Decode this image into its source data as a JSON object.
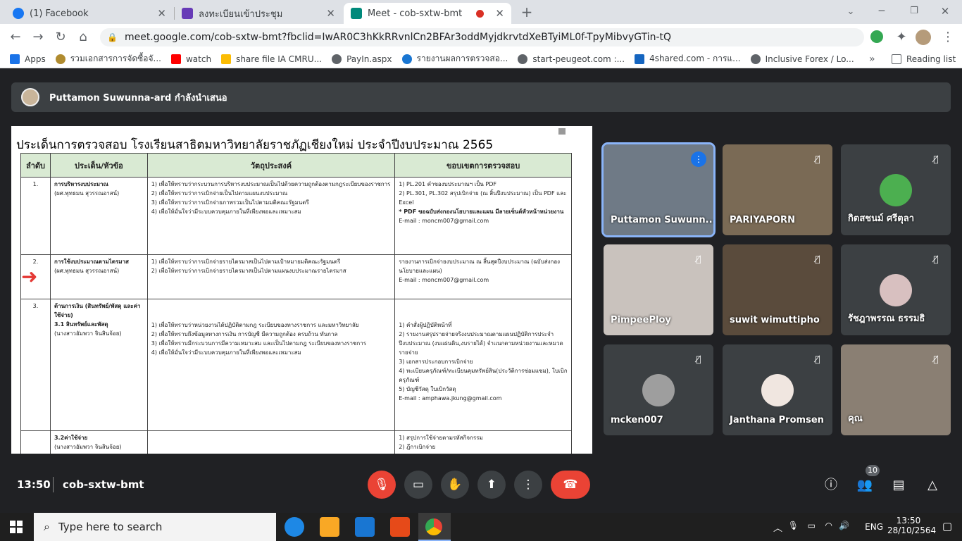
{
  "tabs": [
    {
      "title": "(1) Facebook",
      "color": "#1877f2"
    },
    {
      "title": "ลงทะเบียนเข้าประชุม",
      "color": "#673ab7"
    },
    {
      "title": "Meet - cob-sxtw-bmt",
      "color": "#00897b"
    }
  ],
  "omnibox": {
    "url": "meet.google.com/cob-sxtw-bmt?fbclid=IwAR0C3hKkRRvnlCn2BFAr3oddMyjdkrvtdXeBTyiML0f-TpyMibvyGTin-tQ"
  },
  "bookmarks": [
    {
      "label": "Apps",
      "color": "#1a73e8"
    },
    {
      "label": "รวมเอกสารการจัดซื้อจั...",
      "color": "#b08b2f"
    },
    {
      "label": "watch",
      "color": "#ff0000"
    },
    {
      "label": "share file IA CMRU...",
      "color": "#fbbc04"
    },
    {
      "label": "PayIn.aspx",
      "color": "#5f6368"
    },
    {
      "label": "รายงานผลการตรวจสอ...",
      "color": "#1976d2"
    },
    {
      "label": "start-peugeot.com :...",
      "color": "#5f6368"
    },
    {
      "label": "4shared.com - การแ...",
      "color": "#1565c0"
    },
    {
      "label": "Inclusive Forex / Lo...",
      "color": "#5f6368"
    }
  ],
  "reading_list": "Reading list",
  "presenter": {
    "text": "Puttamon Suwunna-ard กำลังนำเสนอ"
  },
  "slide": {
    "title": "ประเด็นการตรวจสอบ โรงเรียนสาธิตมหาวิทยาลัยราชภัฏเชียงใหม่ ประจำปีงบประมาณ 2565",
    "headers": [
      "ลำดับ",
      "ประเด็น/หัวข้อ",
      "วัตถุประสงค์",
      "ขอบเขตการตรวจสอบ"
    ],
    "rows": [
      {
        "no": "1.",
        "topic": "การบริหารงบประมาณ",
        "owner": "(ผศ.พุทธมน สุวรรณอาสน์)",
        "objectives": [
          "1) เพื่อให้ทราบว่ากระบวนการบริหารงบประมาณเป็นไปด้วยความถูกต้องตามกฎระเบียบของราชการ",
          "2) เพื่อให้ทราบว่าการเบิกจ่ายเป็นไปตามแผนงบประมาณ",
          "3) เพื่อให้ทราบว่าการเบิกจ่ายภาพรวมเป็นไปตามมติคณะรัฐมนตรี",
          "4) เพื่อให้มั่นใจว่ามีระบบควบคุมภายในที่เพียงพอและเหมาะสม"
        ],
        "scope": [
          "1) PL.201 คำของบประมาณฯ เป็น PDF",
          "2) PL.301, PL.302 สรุปเบิกจ่าย (ณ สิ้นปีงบประมาณ) เป็น PDF และ Excel",
          "* PDF ขอฉบับส่งกองนโยบายและแผน มีลายเซ็นต์หัวหน้าหน่วยงาน",
          "E-mail : moncm007@gmail.com"
        ]
      },
      {
        "no": "2.",
        "topic": "การใช้งบประมาณตามไตรมาส",
        "owner": "(ผศ.พุทธมน สุวรรณอาสน์)",
        "objectives": [
          "1) เพื่อให้ทราบว่าการเบิกจ่ายรายไตรมาสเป็นไปตามเป้าหมายมติคณะรัฐมนตรี",
          "2) เพื่อให้ทราบว่าการเบิกจ่ายรายไตรมาสเป็นไปตามแผนงบประมาณรายไตรมาส"
        ],
        "scope": [
          "รายงานการเบิกจ่ายงบประมาณ ณ สิ้นสุดปีงบประมาณ (ฉบับส่งกองนโยบายและแผน)",
          "E-mail : moncm007@gmail.com"
        ]
      },
      {
        "no": "3.",
        "topic": "ด้านการเงิน (สินทรัพย์/พัสดุ และค่าใช้จ่าย)",
        "sub": "3.1 สินทรัพย์และพัสดุ",
        "owner": "(นางสาวอัมพวา จินสินจ้อย)",
        "objectives": [
          "1) เพื่อให้ทราบว่าหน่วยงานได้ปฏิบัติตามกฎ ระเบียบของทางราชการ และมหาวิทยาลัย",
          "2) เพื่อให้ทราบถึงข้อมูลทางการเงิน การบัญชี มีความถูกต้อง ครบถ้วน ทันกาล",
          "3) เพื่อให้ทราบมีกระบวนการมีความเหมาะสม และเป็นไปตามกฎ ระเบียบของทางราชการ",
          "4) เพื่อให้มั่นใจว่ามีระบบควบคุมภายในที่เพียงพอและเหมาะสม"
        ],
        "scope": [
          "1) คำสั่งผู้ปฏิบัติหน้าที่",
          "2) รายงานสรุปรายจ่ายจริงงบประมาณตามแผนปฏิบัติการประจำปีงบประมาณ (งบแผ่นดิน,งบรายได้) จำแนกตามหน่วยงานและหมวดรายจ่าย",
          "3) เอกสารประกอบการเบิกจ่าย",
          "4) ทะเบียนครุภัณฑ์/ทะเบียนคุมทรัพย์สิน(ประวัติการซ่อมแซม), ใบเบิกครุภัณฑ์",
          "5) บัญชีวัสดุ ใบเบิกวัสดุ",
          "E-mail : amphawa.jkung@gmail.com"
        ]
      },
      {
        "no": "",
        "topic": "3.2ค่าใช้จ่าย",
        "owner": "(นางสาวอัมพวา จินสินจ้อย)",
        "objectives": [],
        "scope": [
          "1) สรุปการใช้จ่ายตามรหัสกิจกรรม",
          "2) ฎีกาเบิกจ่าย"
        ]
      }
    ]
  },
  "participants": [
    {
      "name": "Puttamon Suwunn...",
      "bg": "#6f7a86",
      "speaking": true
    },
    {
      "name": "PARIYAPORN",
      "bg": "#7a6a55"
    },
    {
      "name": "กิตสชนม์ ศรีตุลา",
      "bg": "#3c4043",
      "avatar": "#4caf50"
    },
    {
      "name": "PimpeePloy",
      "bg": "#c9c2bd"
    },
    {
      "name": "suwit wimuttipho",
      "bg": "#5a4b3c"
    },
    {
      "name": "รัชฎาพรรณ ธรรมธิ",
      "bg": "#3c4043",
      "avatar": "#d8c0c0"
    },
    {
      "name": "mcken007",
      "bg": "#3c4043",
      "avatar": "#9e9e9e"
    },
    {
      "name": "Janthana Promsen",
      "bg": "#3c4043",
      "avatar": "#f0e6e0"
    },
    {
      "name": "คุณ",
      "bg": "#8a7f73"
    }
  ],
  "bottom": {
    "time": "13:50",
    "meeting_code": "cob-sxtw-bmt",
    "people_count": "10"
  },
  "taskbar": {
    "search_placeholder": "Type here to search",
    "lang": "ENG",
    "time": "13:50",
    "date": "28/10/2564"
  }
}
